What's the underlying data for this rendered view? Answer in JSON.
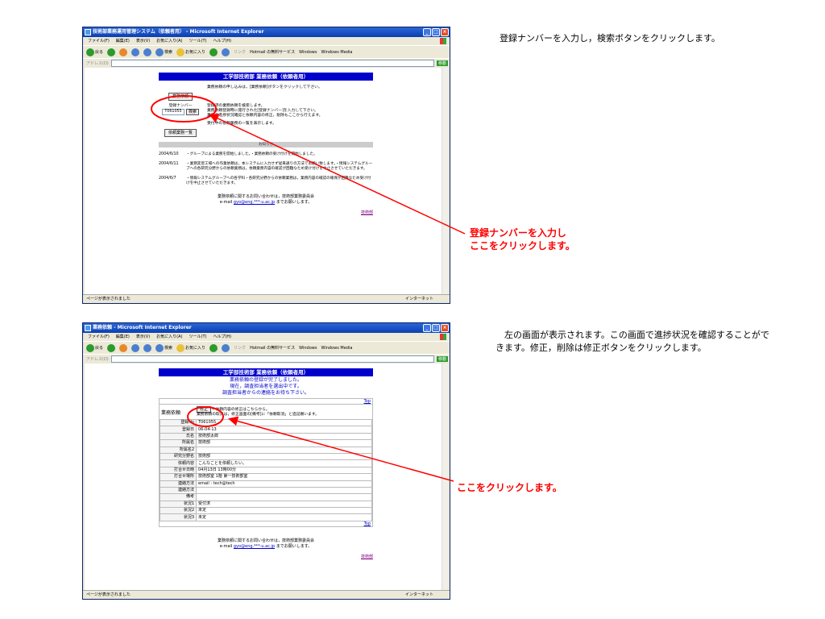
{
  "browser": {
    "title1": "技術部業務運用管理システム（依頼者用） - Microsoft Internet Explorer",
    "title2": "業務依頼 - Microsoft Internet Explorer",
    "menu": [
      "ファイル(F)",
      "編集(E)",
      "表示(V)",
      "お気に入り(A)",
      "ツール(T)",
      "ヘルプ(H)"
    ],
    "toolbar": {
      "back": "戻る",
      "search": "検索",
      "favorites": "お気に入り",
      "links": "リンク",
      "hotmail": "Hotmail の無料サービス",
      "windows": "Windows",
      "media": "Windows Media"
    },
    "address_label": "アドレス(D)",
    "go": "移動",
    "status_left": "ページが表示されました",
    "status_right": "インターネット"
  },
  "page1": {
    "header": "工学部技術部 業務依頼（依頼者用）",
    "btn_request": "業務依頼",
    "desc_request": "業務依頼の申し込みは，[業務依頼]ボタンをクリックして下さい。",
    "reg_label": "登録ナンバー",
    "reg_value": "T061055",
    "btn_search": "検索",
    "desc_search1": "登録済の業務依頼を検索します。",
    "desc_search2": "業務依頼登録時に発行された[登録ナンバー]を入力して下さい。",
    "desc_search3": "業務の進捗状況確認と依頼内容の修正，削除もここから行えます。",
    "btn_list": "依頼業務一覧",
    "desc_list": "受付中の依頼業務の一覧を表示します。",
    "news_title": "お知らせ",
    "news": [
      {
        "date": "2004/6/10",
        "text": "・グループによる業務を開始しました。・業務依頼の受け付けを開始しました。"
      },
      {
        "date": "2004/6/11",
        "text": "・業務実習工場への作業依頼は，本システムに入力せず従来通りの方法でお願い致します。・情報システムグループへの各研究分野からの依頼業務は，依頼業務内容の確認が困難なため受け付けを中止させていただきます。"
      },
      {
        "date": "2004/6/7",
        "text": "・情報システムグループへの各学科・各研究分野からの依頼業務は，業務内容の確認の確保が困難なため受け付けを中止させていただきます。"
      }
    ],
    "footer1": "業務依頼に関するお問い合わせは，技術部業務委員会",
    "footer_email_pre": "e-mail",
    "footer_email": "gyo@eng.***-u.ac.jp",
    "footer_email_post": "までお願いします。",
    "bottom_link": "技術部"
  },
  "page2": {
    "header": "工学部技術部 業務依頼（依頼者用）",
    "msg1": "業務依頼の登録が完了しました。",
    "msg2": "現在，調査担当者を選出中です。",
    "msg3": "調査担当者からの連絡をお待ち下さい。",
    "top": "Top",
    "section_label": "業務依頼",
    "btn_edit": "修正",
    "edit_desc1": "←依頼内容の修正はこちらから。",
    "edit_desc2": "業務依頼の取消は，修正画面の[備考]に「依頼取消」と追記願います。",
    "rows": [
      {
        "label": "登録No",
        "value": "T061055"
      },
      {
        "label": "登録日",
        "value": "06-04-13"
      },
      {
        "label": "氏名",
        "value": "技術部太郎"
      },
      {
        "label": "所属名",
        "value": "技術部"
      },
      {
        "label": "所属名2",
        "value": ""
      },
      {
        "label": "研究分野名",
        "value": "技術部"
      },
      {
        "label": "依頼内容",
        "value": "こんなことを依頼したい。"
      },
      {
        "label": "打合せ日時",
        "value": "04月13日 13時00分"
      },
      {
        "label": "打合せ場所",
        "value": "技術部室 1階 第一技術部室"
      },
      {
        "label": "連絡方法",
        "value": "email : tech@tech"
      },
      {
        "label": "連絡方法",
        "value": ""
      },
      {
        "label": "備考",
        "value": ""
      },
      {
        "label": "状況1",
        "value": "受付済"
      },
      {
        "label": "状況2",
        "value": "未定"
      },
      {
        "label": "状況3",
        "value": "未定"
      }
    ],
    "footer1": "業務依頼に関するお問い合わせは，技術部業務委員会",
    "footer_email_pre": "e-mail",
    "footer_email": "gyo@eng.***-u.ac.jp",
    "footer_email_post": "までお願いします。",
    "bottom_link": "技術部"
  },
  "instructions": {
    "step1": "登録ナンバーを入力し，検索ボタンをクリックします。",
    "red1_line1": "登録ナンバーを入力し",
    "red1_line2": "ここをクリックします。",
    "step2": "左の画面が表示されます。この画面で進捗状況を確認することができます。修正，削除は修正ボタンをクリックします。",
    "red2": "ここをクリックします。"
  },
  "colors": {
    "annotation": "#ff0000",
    "header_bar": "#0000cc"
  }
}
